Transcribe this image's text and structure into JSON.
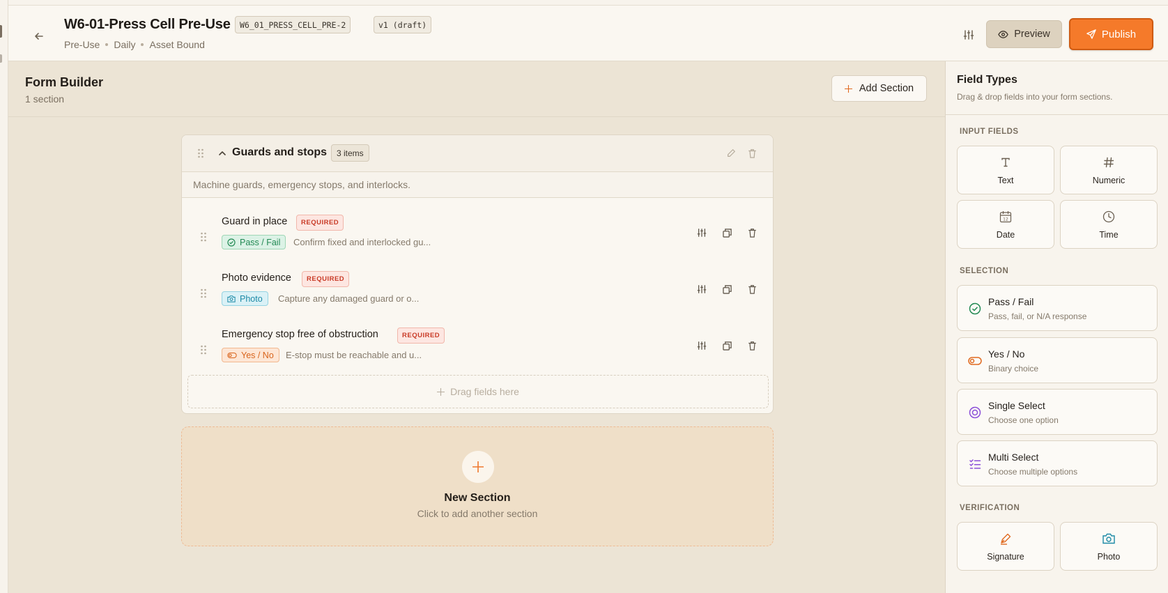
{
  "header": {
    "title": "W6-01-Press Cell Pre-Use",
    "code": "W6_01_PRESS_CELL_PRE-2",
    "version": "v1 (draft)",
    "meta": [
      "Pre-Use",
      "Daily",
      "Asset Bound"
    ],
    "preview_label": "Preview",
    "publish_label": "Publish"
  },
  "builder": {
    "title": "Form Builder",
    "count": "1 section",
    "add_section_label": "Add Section"
  },
  "section": {
    "name": "Guards and stops",
    "item_count": "3 items",
    "description": "Machine guards, emergency stops, and interlocks.",
    "fields": [
      {
        "name": "Guard in place",
        "required": "REQUIRED",
        "type": "Pass / Fail",
        "hint": "Confirm fixed and interlocked gu..."
      },
      {
        "name": "Photo evidence",
        "required": "REQUIRED",
        "type": "Photo",
        "hint": "Capture any damaged guard or o..."
      },
      {
        "name": "Emergency stop free of obstruction",
        "required": "REQUIRED",
        "type": "Yes / No",
        "hint": "E-stop must be reachable and u..."
      }
    ],
    "drop_label": "Drag fields here"
  },
  "new_section": {
    "title": "New Section",
    "subtitle": "Click to add another section"
  },
  "panel": {
    "title": "Field Types",
    "subtitle": "Drag & drop fields into your form sections.",
    "groups": {
      "input": "INPUT FIELDS",
      "selection": "SELECTION",
      "verification": "VERIFICATION"
    },
    "input_fields": [
      "Text",
      "Numeric",
      "Date",
      "Time"
    ],
    "selection_fields": [
      {
        "title": "Pass / Fail",
        "desc": "Pass, fail, or N/A response"
      },
      {
        "title": "Yes / No",
        "desc": "Binary choice"
      },
      {
        "title": "Single Select",
        "desc": "Choose one option"
      },
      {
        "title": "Multi Select",
        "desc": "Choose multiple options"
      }
    ],
    "verification_fields": [
      "Signature",
      "Photo"
    ],
    "date_icon_number": "12"
  },
  "colors": {
    "accent": "#f57a2a",
    "pass": "#238a54",
    "photo": "#1d8aa6",
    "yesno": "#d9641c",
    "required": "#c93b27",
    "select": "#8b4fd8"
  }
}
